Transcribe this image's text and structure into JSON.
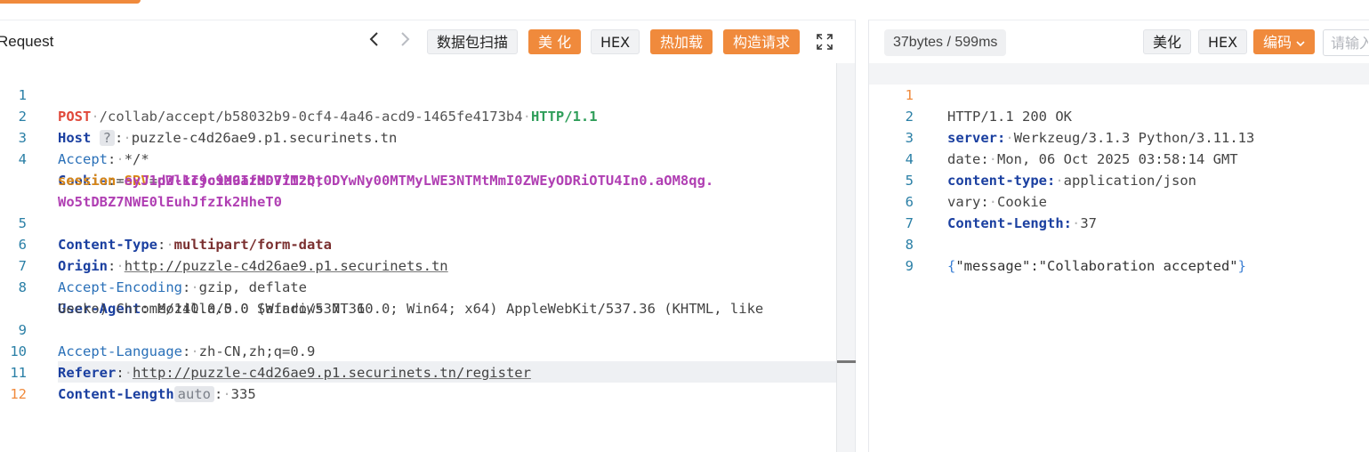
{
  "request_panel": {
    "title": "Request",
    "toolbar": {
      "scan_label": "数据包扫描",
      "beautify_label": "美 化",
      "hex_label": "HEX",
      "hot_reload_label": "热加载",
      "construct_label": "构造请求"
    },
    "lines": [
      {
        "num": "1",
        "method": "POST",
        "path": "/collab/accept/b58032b9-0cf4-4a46-acd9-1465fe4173b4",
        "proto": "HTTP/1.1"
      },
      {
        "num": "2",
        "name": "Host",
        "tag": "?",
        "value": "puzzle-c4d26ae9.p1.securinets.tn"
      },
      {
        "num": "3",
        "name": "Accept",
        "value": "*/*"
      },
      {
        "num": "4",
        "name": "Cookie",
        "c1_key": "SRV",
        "c1_val": "p2-1c9c9a9afd07712b;",
        "c2_key": "session",
        "c2_val": "eyJ1dWlkIjoiMGIzMDViMzQtODYwNy00MTMyLWE3NTMtMmI0ZWEyODRiOTU4In0.aOM8qg.",
        "c2_val_cont": "Wo5tDBZ7NWE0lEuhJfzIk2HheT0"
      },
      {
        "num": "5",
        "name": "Content-Type",
        "value": "multipart/form-data"
      },
      {
        "num": "6",
        "name": "Origin",
        "value": "http://puzzle-c4d26ae9.p1.securinets.tn"
      },
      {
        "num": "7",
        "name": "Accept-Encoding",
        "value": "gzip, deflate"
      },
      {
        "num": "8",
        "name": "User-Agent",
        "value": "Mozilla/5.0 (Windows NT 10.0; Win64; x64) AppleWebKit/537.36 (KHTML, like",
        "value_cont": "Gecko) Chrome/140.0.0.0 Safari/537.36"
      },
      {
        "num": "9",
        "name": "Accept-Language",
        "value": "zh-CN,zh;q=0.9"
      },
      {
        "num": "10",
        "name": "Referer",
        "value": "http://puzzle-c4d26ae9.p1.securinets.tn/register"
      },
      {
        "num": "11",
        "name": "Content-Length",
        "tag": "auto",
        "value": "335"
      },
      {
        "num": "12"
      }
    ]
  },
  "response_panel": {
    "stats": "37bytes / 599ms",
    "toolbar": {
      "beautify_label": "美化",
      "hex_label": "HEX",
      "encode_label": "编码",
      "search_placeholder": "请输入"
    },
    "lines": [
      {
        "num": "1",
        "text": "HTTP/1.1 200 OK"
      },
      {
        "num": "2",
        "name": "server",
        "value": "Werkzeug/3.1.3 Python/3.11.13"
      },
      {
        "num": "3",
        "name": "date",
        "value": "Mon, 06 Oct 2025 03:58:14 GMT"
      },
      {
        "num": "4",
        "name": "content-type",
        "value": "application/json"
      },
      {
        "num": "5",
        "name": "vary",
        "value": "Cookie"
      },
      {
        "num": "6",
        "name": "Content-Length",
        "value": "37"
      },
      {
        "num": "7"
      },
      {
        "num": "8",
        "json_open": "{",
        "json_body": "\"message\":\"Collaboration accepted\"",
        "json_close": "}"
      },
      {
        "num": "9"
      }
    ]
  },
  "colors": {
    "accent": "#f08a3c",
    "header_name": "#1a3fa0",
    "line_number": "#2a7fa6"
  }
}
